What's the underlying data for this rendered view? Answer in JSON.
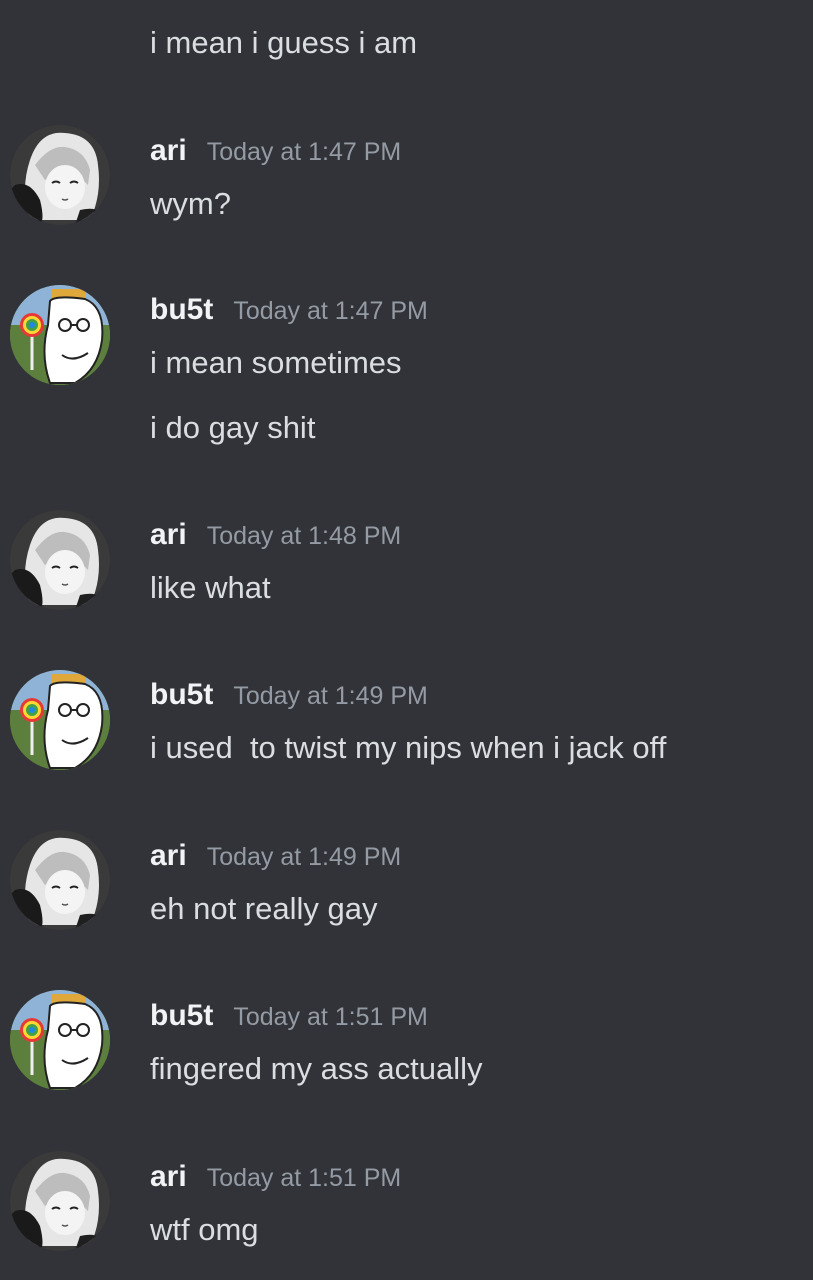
{
  "messages": {
    "m0": {
      "text": "i mean i guess i am"
    },
    "m1": {
      "author": "ari",
      "time": "Today at 1:47 PM",
      "text": "wym?",
      "avatar": "anime-girl-avatar-icon"
    },
    "m2": {
      "author": "bu5t",
      "time": "Today at 1:47 PM",
      "text": "i mean sometimes",
      "text2": "i do gay shit",
      "avatar": "wojak-lollipop-avatar-icon"
    },
    "m3": {
      "author": "ari",
      "time": "Today at 1:48 PM",
      "text": "like what",
      "avatar": "anime-girl-avatar-icon"
    },
    "m4": {
      "author": "bu5t",
      "time": "Today at 1:49 PM",
      "text": "i used  to twist my nips when i jack off",
      "avatar": "wojak-lollipop-avatar-icon"
    },
    "m5": {
      "author": "ari",
      "time": "Today at 1:49 PM",
      "text": "eh not really gay",
      "avatar": "anime-girl-avatar-icon"
    },
    "m6": {
      "author": "bu5t",
      "time": "Today at 1:51 PM",
      "text": "fingered my ass actually",
      "avatar": "wojak-lollipop-avatar-icon"
    },
    "m7": {
      "author": "ari",
      "time": "Today at 1:51 PM",
      "text": "wtf omg",
      "avatar": "anime-girl-avatar-icon"
    }
  },
  "colors": {
    "background": "#313338",
    "text": "#dbdee1",
    "username": "#f2f3f5",
    "timestamp": "#949ba4"
  }
}
